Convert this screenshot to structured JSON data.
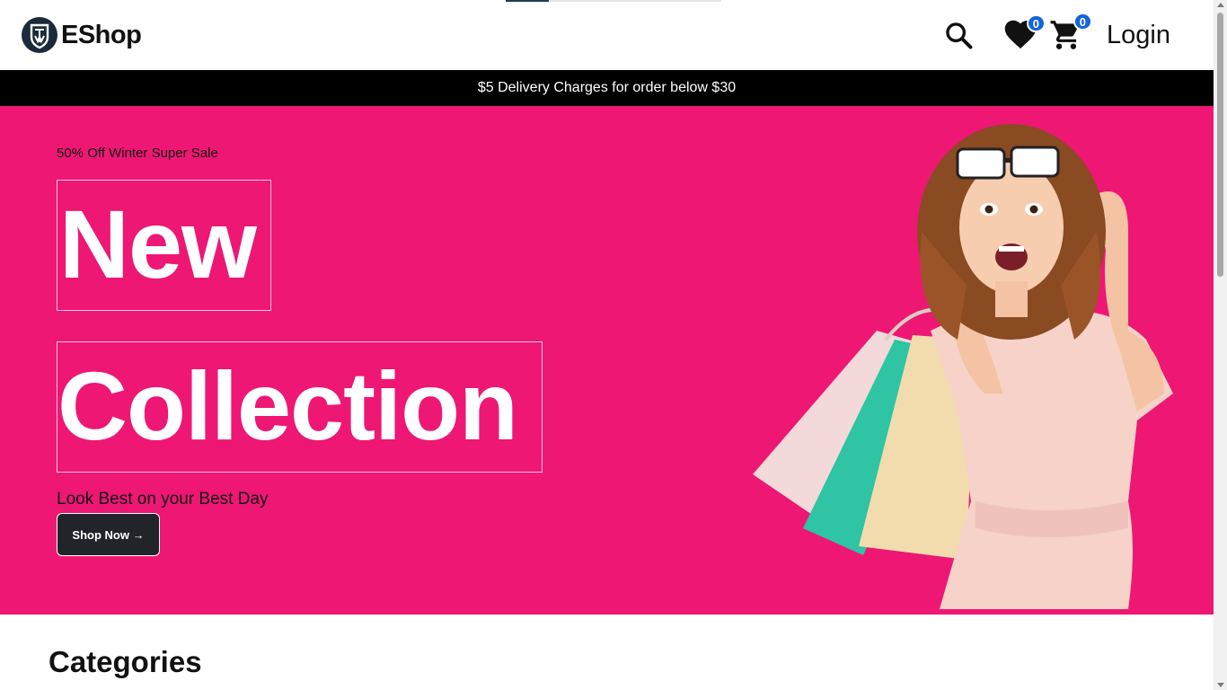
{
  "brand": {
    "name": "EShop",
    "logo_icon": "shield-logo-icon"
  },
  "header": {
    "search_icon": "search-icon",
    "wishlist_icon": "heart-icon",
    "wishlist_count": "0",
    "cart_icon": "cart-icon",
    "cart_count": "0",
    "login_label": "Login"
  },
  "announcement": {
    "text": "$5 Delivery Charges for order below $30"
  },
  "hero": {
    "kicker": "50% Off Winter Super Sale",
    "headline_line1": "New",
    "headline_line2": "Collection",
    "tagline": "Look Best on your Best Day",
    "cta_label": "Shop Now →",
    "background_color": "#ee1774"
  },
  "sections": {
    "categories_title": "Categories"
  },
  "colors": {
    "accent": "#ee1774",
    "badge": "#1565d8",
    "button": "#212529"
  }
}
